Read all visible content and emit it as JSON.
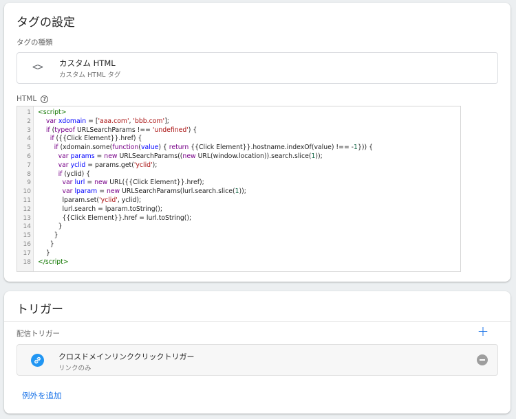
{
  "tag_config": {
    "title": "タグの設定",
    "type_section_label": "タグの種類",
    "tag_type": {
      "icon": "code-brackets-icon",
      "icon_glyph": "<>",
      "name": "カスタム HTML",
      "subtitle": "カスタム HTML タグ"
    },
    "html_label": "HTML",
    "help_icon_glyph": "?",
    "code_lines": [
      "1",
      "2",
      "3",
      "4",
      "5",
      "6",
      "7",
      "8",
      "9",
      "10",
      "11",
      "12",
      "13",
      "14",
      "15",
      "16",
      "17",
      "18"
    ]
  },
  "trigger": {
    "title": "トリガー",
    "firing_label": "配信トリガー",
    "add_glyph": "+",
    "items": [
      {
        "icon": "link-icon",
        "name": "クロスドメインリンククリックトリガー",
        "subtitle": "リンクのみ"
      }
    ],
    "add_exception_label": "例外を追加"
  },
  "colors": {
    "accent_blue": "#1a73e8",
    "link_icon_bg": "#2196f3",
    "remove_icon_bg": "#9e9e9e",
    "code_tag": "#117700",
    "code_keyword": "#770088",
    "code_variable": "#0000ff",
    "code_string": "#aa1111",
    "code_number": "#116644"
  }
}
